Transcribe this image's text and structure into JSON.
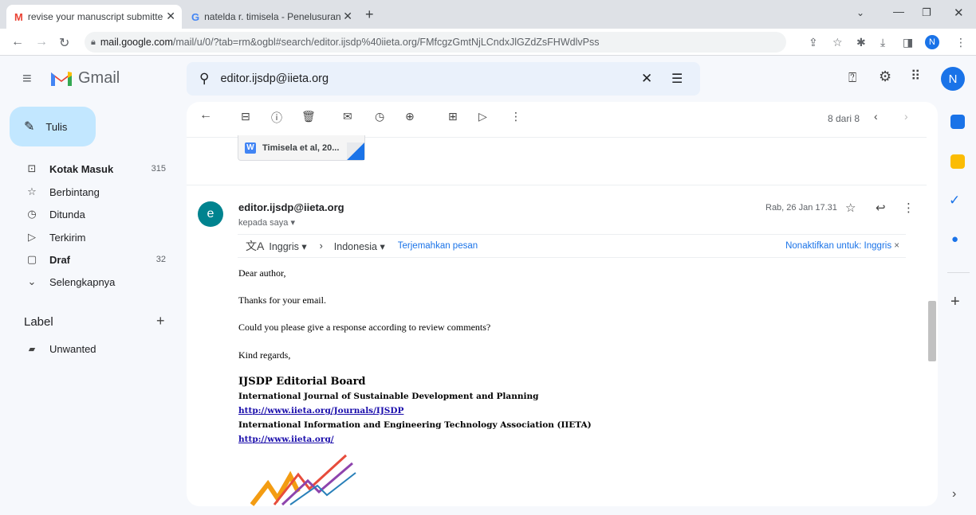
{
  "browser": {
    "tabs": [
      {
        "label": "revise your manuscript submitte"
      },
      {
        "label": "natelda r. timisela - Penelusuran"
      }
    ],
    "new_tab": "+",
    "url_host": "mail.google.com",
    "url_rest": "/mail/u/0/?tab=rm&ogbl#search/editor.ijsdp%40iieta.org/FMfcgzGmtNjLCndxJlGZdZsFHWdlvPss",
    "profile_initial": "N"
  },
  "gmail": {
    "logo_text": "Gmail",
    "compose_label": "Tulis",
    "search_value": "editor.ijsdp@iieta.org",
    "avatar_initial": "N",
    "sidebar": [
      {
        "label": "Kotak Masuk",
        "count": "315",
        "bold": true,
        "icon": "inbox-icon"
      },
      {
        "label": "Berbintang",
        "count": "",
        "bold": false,
        "icon": "star-icon"
      },
      {
        "label": "Ditunda",
        "count": "",
        "bold": false,
        "icon": "clock-icon"
      },
      {
        "label": "Terkirim",
        "count": "",
        "bold": false,
        "icon": "send-icon"
      },
      {
        "label": "Draf",
        "count": "32",
        "bold": true,
        "icon": "draft-icon"
      },
      {
        "label": "Selengkapnya",
        "count": "",
        "bold": false,
        "icon": "chevron-down-icon"
      }
    ],
    "label_heading": "Label",
    "labels": [
      {
        "label": "Unwanted"
      }
    ],
    "pagination": "8 dari 8"
  },
  "attachment": {
    "name": "Timisela et al, 20..."
  },
  "message": {
    "avatar_initial": "e",
    "sender": "editor.ijsdp@iieta.org",
    "recipient": "kepada saya",
    "date": "Rab, 26 Jan 17.31",
    "translate": {
      "from": "Inggris",
      "to": "Indonesia",
      "action": "Terjemahkan pesan",
      "disable": "Nonaktifkan untuk: Inggris"
    },
    "body": [
      "Dear author,",
      "Thanks for your email.",
      "Could you please give a response according to review comments?",
      "Kind regards,"
    ],
    "signature": {
      "title": "IJSDP Editorial Board",
      "journal": "International Journal of Sustainable Development and Planning",
      "journal_url": "http://www.iieta.org/Journals/IJSDP",
      "association": "International Information and Engineering Technology Association (IIETA)",
      "association_url": "http://www.iieta.org/"
    }
  }
}
